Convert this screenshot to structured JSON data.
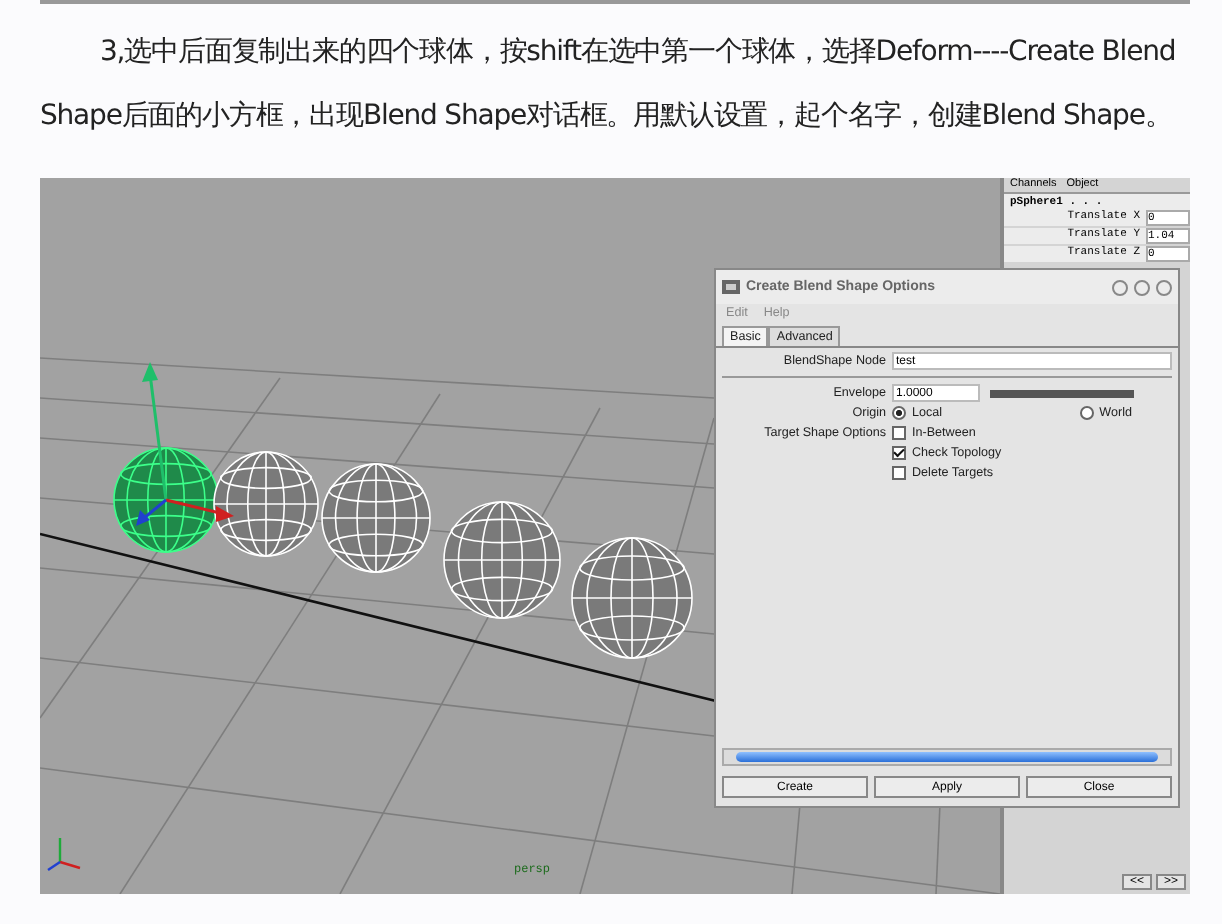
{
  "article": {
    "paragraph": "3,选中后面复制出来的四个球体，按shift在选中第一个球体，选择Deform----Create Blend Shape后面的小方框，出现Blend Shape对话框。用默认设置，起个名字，创建Blend Shape。"
  },
  "viewport": {
    "camera_label": "persp",
    "spheres": [
      {
        "selected": true
      },
      {
        "selected": false
      },
      {
        "selected": false
      },
      {
        "selected": false
      },
      {
        "selected": false
      }
    ]
  },
  "channel_box": {
    "menus": [
      "Channels",
      "Object"
    ],
    "object": "pSphere1 . . .",
    "channels": [
      {
        "name": "Translate X",
        "value": "0"
      },
      {
        "name": "Translate Y",
        "value": "1.04"
      },
      {
        "name": "Translate Z",
        "value": "0"
      }
    ],
    "nav": [
      "<<",
      ">>"
    ]
  },
  "dialog": {
    "title": "Create Blend Shape Options",
    "menus": [
      "Edit",
      "Help"
    ],
    "tabs": [
      {
        "label": "Basic",
        "selected": true
      },
      {
        "label": "Advanced",
        "selected": false
      }
    ],
    "node_label": "BlendShape Node",
    "node_value": "test",
    "envelope": {
      "label": "Envelope",
      "value": "1.0000",
      "level": 1.0
    },
    "origin_label": "Origin",
    "origins": [
      {
        "label": "Local",
        "selected": true
      },
      {
        "label": "World",
        "selected": false
      }
    ],
    "target_label": "Target Shape Options",
    "targets": [
      {
        "label": "In-Between",
        "checked": false
      },
      {
        "label": "Check Topology",
        "checked": true
      },
      {
        "label": "Delete Targets",
        "checked": false
      }
    ],
    "buttons": [
      "Create",
      "Apply",
      "Close"
    ]
  }
}
